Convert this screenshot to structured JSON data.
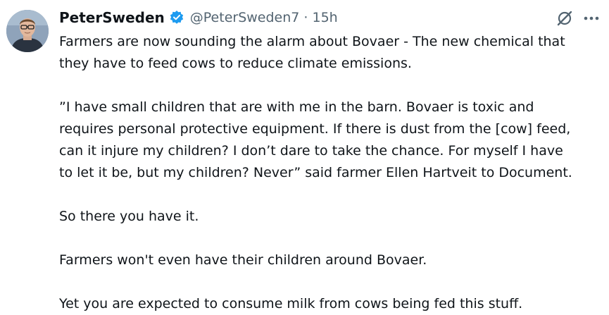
{
  "author": {
    "display_name": "PeterSweden",
    "handle": "@PeterSweden7",
    "separator": " · ",
    "time": "15h",
    "verified": true
  },
  "colors": {
    "verified_badge": "#1d9bf0",
    "text_primary": "#0f1419",
    "text_secondary": "#536471"
  },
  "icons": {
    "grok": "grok-icon",
    "more": "more-options-icon",
    "verified": "verified-badge-icon"
  },
  "tweet": {
    "paragraphs": [
      {
        "lines": [
          "Farmers are now sounding the alarm about Bovaer - The new chemical that",
          "they have to feed cows to reduce climate emissions."
        ]
      },
      {
        "lines": [
          "”I have small children that are with me in the barn. Bovaer is toxic and",
          "requires personal protective equipment. If there is dust from the [cow] feed,",
          "can it injure my children? I don’t dare to take the chance. For myself I have",
          "to let it be, but my children? Never” said farmer Ellen Hartveit to Document."
        ]
      },
      {
        "lines": [
          "So there you have it."
        ]
      },
      {
        "lines": [
          "Farmers won't even have their children around Bovaer."
        ]
      },
      {
        "lines": [
          "Yet you are expected to consume milk from cows being fed this stuff."
        ]
      }
    ]
  }
}
